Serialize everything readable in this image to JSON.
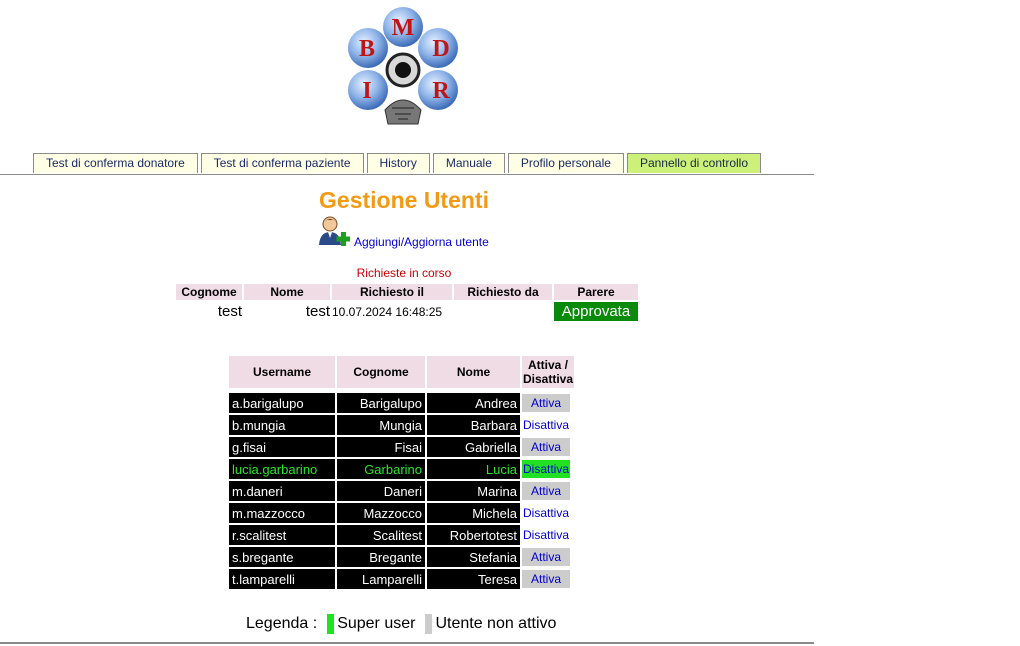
{
  "logo": {
    "letters": [
      "M",
      "D",
      "R",
      "I",
      "B"
    ]
  },
  "tabs": [
    {
      "label": "Test di conferma donatore",
      "active": false
    },
    {
      "label": "Test di conferma paziente",
      "active": false
    },
    {
      "label": "History",
      "active": false
    },
    {
      "label": "Manuale",
      "active": false
    },
    {
      "label": "Profilo personale",
      "active": false
    },
    {
      "label": "Pannello di controllo",
      "active": true
    }
  ],
  "page_title": "Gestione Utenti",
  "add_user_label": "Aggiungi/Aggiorna utente",
  "requests": {
    "caption": "Richieste in corso",
    "headers": [
      "Cognome",
      "Nome",
      "Richiesto il",
      "Richiesto da",
      "Parere"
    ],
    "rows": [
      {
        "cognome": "test",
        "nome": "test",
        "richiesto_il": "10.07.2024 16:48:25",
        "richiesto_da": "",
        "parere": "Approvata"
      }
    ]
  },
  "users": {
    "headers": [
      "Username",
      "Cognome",
      "Nome",
      "Attiva / Disattiva"
    ],
    "rows": [
      {
        "username": "a.barigalupo",
        "cognome": "Barigalupo",
        "nome": "Andrea",
        "action": "Attiva",
        "state": "inactive"
      },
      {
        "username": "b.mungia",
        "cognome": "Mungia",
        "nome": "Barbara",
        "action": "Disattiva",
        "state": "active"
      },
      {
        "username": "g.fisai",
        "cognome": "Fisai",
        "nome": "Gabriella",
        "action": "Attiva",
        "state": "inactive"
      },
      {
        "username": "lucia.garbarino",
        "cognome": "Garbarino",
        "nome": "Lucia",
        "action": "Disattiva",
        "state": "super"
      },
      {
        "username": "m.daneri",
        "cognome": "Daneri",
        "nome": "Marina",
        "action": "Attiva",
        "state": "inactive"
      },
      {
        "username": "m.mazzocco",
        "cognome": "Mazzocco",
        "nome": "Michela",
        "action": "Disattiva",
        "state": "active"
      },
      {
        "username": "r.scalitest",
        "cognome": "Scalitest",
        "nome": "Robertotest",
        "action": "Disattiva",
        "state": "active"
      },
      {
        "username": "s.bregante",
        "cognome": "Bregante",
        "nome": "Stefania",
        "action": "Attiva",
        "state": "inactive"
      },
      {
        "username": "t.lamparelli",
        "cognome": "Lamparelli",
        "nome": "Teresa",
        "action": "Attiva",
        "state": "inactive"
      }
    ]
  },
  "legend": {
    "label": "Legenda :",
    "items": [
      {
        "label": "Super user",
        "color": "#22e022"
      },
      {
        "label": "Utente non attivo",
        "color": "#cccccc"
      }
    ]
  }
}
